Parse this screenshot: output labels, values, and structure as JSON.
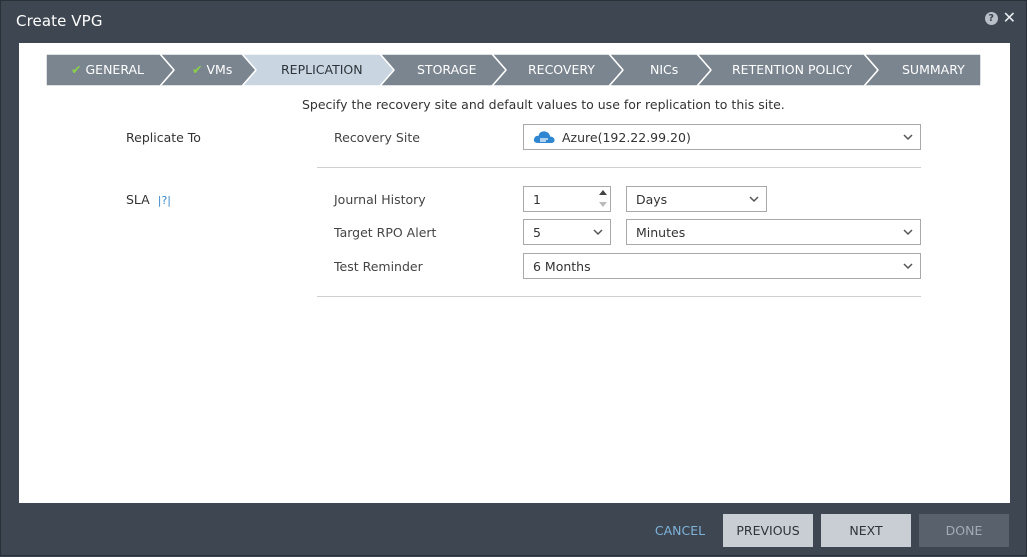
{
  "window": {
    "title": "Create VPG",
    "help_icon": "?",
    "close_icon": "✕"
  },
  "steps": [
    {
      "label": "GENERAL",
      "done": true,
      "state": "completed"
    },
    {
      "label": "VMs",
      "done": true,
      "state": "completed"
    },
    {
      "label": "REPLICATION",
      "done": false,
      "state": "active"
    },
    {
      "label": "STORAGE",
      "done": false,
      "state": "pending"
    },
    {
      "label": "RECOVERY",
      "done": false,
      "state": "pending"
    },
    {
      "label": "NICs",
      "done": false,
      "state": "pending"
    },
    {
      "label": "RETENTION POLICY",
      "done": false,
      "state": "pending"
    },
    {
      "label": "SUMMARY",
      "done": false,
      "state": "pending"
    }
  ],
  "intro": "Specify the recovery site and default values to use for replication to this site.",
  "replicate_to": {
    "section_label": "Replicate To",
    "recovery_site_label": "Recovery Site",
    "recovery_site_value": "Azure(192.22.99.20)"
  },
  "sla": {
    "section_label": "SLA",
    "help": "|?|",
    "journal_history_label": "Journal History",
    "journal_history_value": "1",
    "journal_history_unit": "Days",
    "target_rpo_label": "Target RPO Alert",
    "target_rpo_value": "5",
    "target_rpo_unit": "Minutes",
    "test_reminder_label": "Test Reminder",
    "test_reminder_value": "6 Months"
  },
  "footer": {
    "cancel": "CANCEL",
    "previous": "PREVIOUS",
    "next": "NEXT",
    "done": "DONE"
  },
  "colors": {
    "frame": "#3d4651",
    "step_completed": "#7b8590",
    "step_active": "#c9d6e2",
    "step_pending": "#7b8590",
    "check": "#8bd14a",
    "accent_link": "#7fb3d9",
    "azure_blue": "#2f86d1"
  }
}
